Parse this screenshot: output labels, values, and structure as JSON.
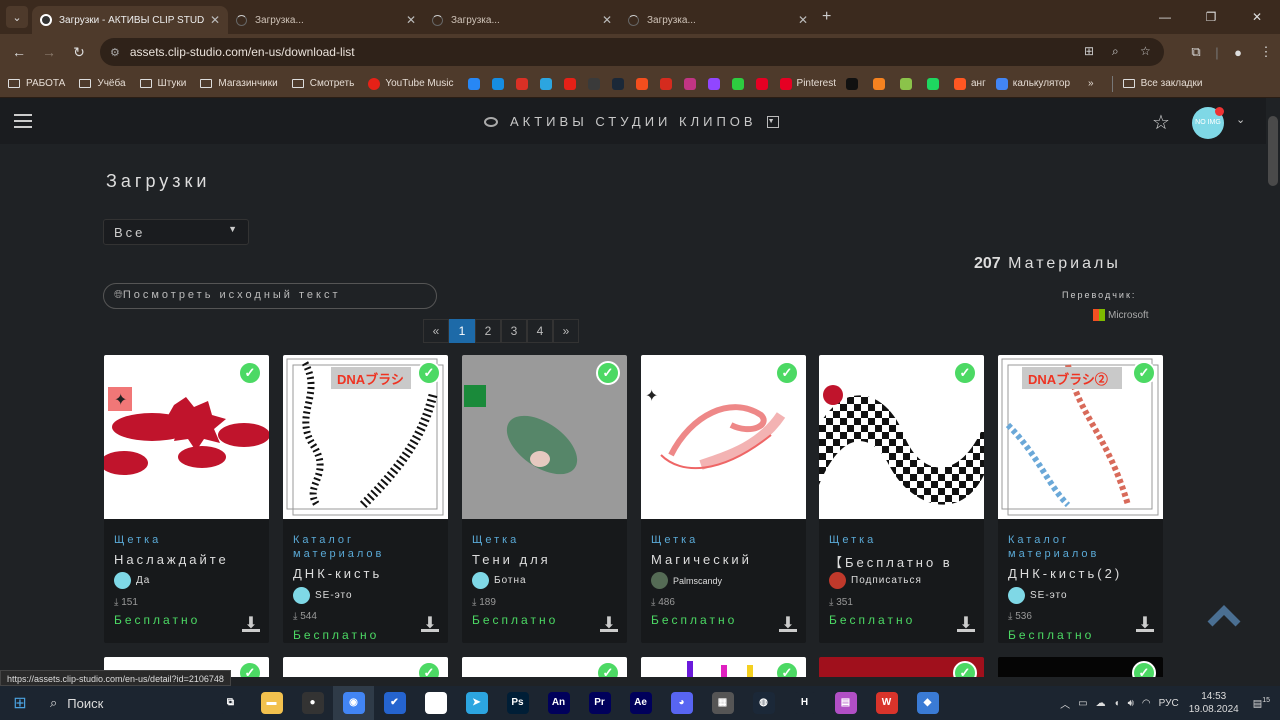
{
  "browser": {
    "tabs": [
      {
        "title": "Загрузки - АКТИВЫ CLIP STUDIO",
        "active": true
      },
      {
        "title": "Загрузка...",
        "active": false
      },
      {
        "title": "Загрузка...",
        "active": false
      },
      {
        "title": "Загрузка...",
        "active": false
      }
    ],
    "url": "assets.clip-studio.com/en-us/download-list",
    "bookmarks": [
      {
        "label": "РАБОТА",
        "type": "folder"
      },
      {
        "label": "Учёба",
        "type": "folder"
      },
      {
        "label": "Штуки",
        "type": "folder"
      },
      {
        "label": "Магазинчики",
        "type": "folder"
      },
      {
        "label": "Смотреть",
        "type": "folder"
      },
      {
        "label": "YouTube Music",
        "type": "site",
        "color": "#e62117"
      }
    ],
    "bookmark_icons": [
      {
        "name": "vk-icon",
        "color": "#2787f5"
      },
      {
        "name": "mail-icon",
        "color": "#168de2"
      },
      {
        "name": "gmail-icon",
        "color": "#d93025"
      },
      {
        "name": "telegram-icon",
        "color": "#2ca5e0"
      },
      {
        "name": "youtube-icon",
        "color": "#e62117"
      },
      {
        "name": "play-icon",
        "color": "#3a3a3a"
      },
      {
        "name": "steam-icon",
        "color": "#1b2838"
      },
      {
        "name": "figma-icon",
        "color": "#f24e1e"
      },
      {
        "name": "ru-flag-icon",
        "color": "#d52b1e"
      },
      {
        "name": "instagram-icon",
        "color": "#c13584"
      },
      {
        "name": "twitch-icon",
        "color": "#9146ff"
      },
      {
        "name": "app-icon",
        "color": "#2ecc40"
      },
      {
        "name": "pinterest-icon",
        "color": "#e60023"
      }
    ],
    "bookmarks_tail": [
      {
        "label": "Pinterest",
        "color": "#e60023"
      },
      {
        "label": "",
        "color": "#111"
      },
      {
        "label": "",
        "color": "#f58220"
      },
      {
        "label": "",
        "color": "#8bc34a"
      },
      {
        "label": "",
        "color": "#1ed760"
      },
      {
        "label": "анг",
        "color": "#ff5722"
      },
      {
        "label": "калькулятор",
        "color": "#4285f4"
      }
    ],
    "more_label": "»",
    "all_bookmarks_label": "Все закладки"
  },
  "site": {
    "brand": "АКТИВЫ СТУДИИ КЛИПОВ",
    "avatar_text": "NO IMG"
  },
  "page": {
    "title": "Загрузки",
    "filter": "Все",
    "count_number": "207",
    "count_label": "Материалы",
    "view_original": "Посмотреть исходный текст",
    "translator_label": "Переводчик:",
    "translator_name": "Microsoft",
    "pagination": [
      "«",
      "1",
      "2",
      "3",
      "4",
      "»"
    ]
  },
  "cards": [
    {
      "category": "Щетка",
      "title": "Наслаждайте",
      "author": "Да",
      "downloads": "151",
      "price": "Бесплатно",
      "avatar_color": "#7fd8e6"
    },
    {
      "category": "Каталог материалов",
      "title": "ДНК-кисть",
      "author": "SE-это",
      "downloads": "544",
      "price": "Бесплатно",
      "avatar_color": "#7fd8e6",
      "label": "DNAブラシ"
    },
    {
      "category": "Щетка",
      "title": "Тени для",
      "author": "Ботна",
      "downloads": "189",
      "price": "Бесплатно",
      "avatar_color": "#7fd8e6"
    },
    {
      "category": "Щетка",
      "title": "Магический",
      "author": "Palmscandy",
      "downloads": "486",
      "price": "Бесплатно",
      "avatar_color": "#556b55"
    },
    {
      "category": "Щетка",
      "title": "【Бесплатно в",
      "author": "Подписаться",
      "downloads": "351",
      "price": "Бесплатно",
      "avatar_color": "#c0392b"
    },
    {
      "category": "Каталог материалов",
      "title": "ДНК-кисть(2)",
      "author": "SE-это",
      "downloads": "536",
      "price": "Бесплатно",
      "avatar_color": "#7fd8e6",
      "label": "DNAブラシ②"
    }
  ],
  "status_url": "https://assets.clip-studio.com/en-us/detail?id=2106748",
  "taskbar": {
    "search": "Поиск",
    "apps": [
      {
        "name": "task-view-icon",
        "label": "⧉",
        "color": "#1c2530"
      },
      {
        "name": "explorer-icon",
        "label": "▬",
        "color": "#f2c14e"
      },
      {
        "name": "obs-icon",
        "label": "●",
        "color": "#333"
      },
      {
        "name": "chrome-icon",
        "label": "◉",
        "color": "#4285f4",
        "active": true
      },
      {
        "name": "todo-icon",
        "label": "✔",
        "color": "#2564cf"
      },
      {
        "name": "clip-studio-icon",
        "label": "◎",
        "color": "#fff"
      },
      {
        "name": "telegram-icon",
        "label": "➤",
        "color": "#2ca5e0"
      },
      {
        "name": "photoshop-icon",
        "label": "Ps",
        "color": "#001e36"
      },
      {
        "name": "animate-icon",
        "label": "An",
        "color": "#00005b"
      },
      {
        "name": "premiere-icon",
        "label": "Pr",
        "color": "#00005b"
      },
      {
        "name": "after-effects-icon",
        "label": "Ae",
        "color": "#00005b"
      },
      {
        "name": "discord-icon",
        "label": "◕",
        "color": "#5865f2"
      },
      {
        "name": "film-icon",
        "label": "▦",
        "color": "#555"
      },
      {
        "name": "steam-icon",
        "label": "◍",
        "color": "#1b2838"
      },
      {
        "name": "h-app-icon",
        "label": "H",
        "color": "#1c2530"
      },
      {
        "name": "notes-icon",
        "label": "▤",
        "color": "#b14fc5"
      },
      {
        "name": "wps-icon",
        "label": "W",
        "color": "#d9342b"
      },
      {
        "name": "app-icon",
        "label": "◆",
        "color": "#3a7bd5"
      }
    ],
    "lang": "РУС",
    "time": "14:53",
    "date": "19.08.2024",
    "notifications": "15"
  }
}
